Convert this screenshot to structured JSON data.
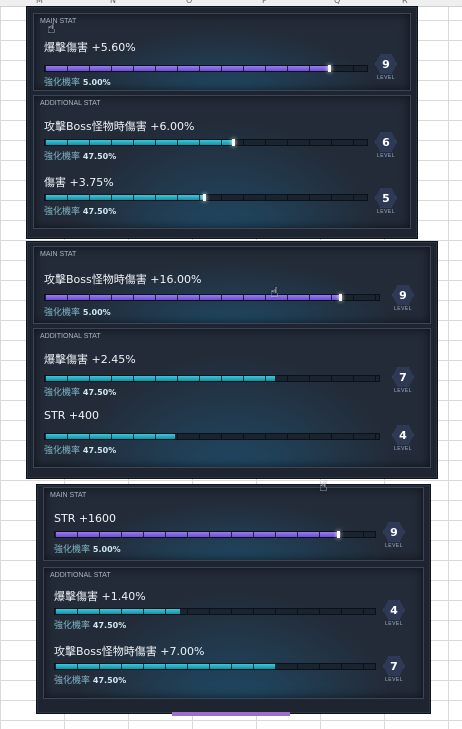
{
  "column_headers": [
    "M",
    "N",
    "O",
    "P",
    "Q",
    "R"
  ],
  "panels": [
    {
      "main": {
        "title": "MAIN STAT",
        "stat": "爆擊傷害 +5.60%",
        "fill": 0.89,
        "rate_label": "強化機率",
        "rate_value": "5.00%",
        "level": "9",
        "level_label": "LEVEL"
      },
      "additional": {
        "title": "ADDITIONAL STAT",
        "stats": [
          {
            "stat": "攻擊Boss怪物時傷害 +6.00%",
            "fill": 0.59,
            "rate_label": "強化機率",
            "rate_value": "47.50%",
            "level": "6",
            "level_label": "LEVEL"
          },
          {
            "stat": "傷害 +3.75%",
            "fill": 0.5,
            "rate_label": "強化機率",
            "rate_value": "47.50%",
            "level": "5",
            "level_label": "LEVEL"
          }
        ]
      }
    },
    {
      "main": {
        "title": "MAIN STAT",
        "stat": "攻擊Boss怪物時傷害 +16.00%",
        "fill": 0.89,
        "rate_label": "強化機率",
        "rate_value": "5.00%",
        "level": "9",
        "level_label": "LEVEL"
      },
      "additional": {
        "title": "ADDITIONAL STAT",
        "stats": [
          {
            "stat": "爆擊傷害 +2.45%",
            "fill": 0.69,
            "rate_label": "強化機率",
            "rate_value": "47.50%",
            "level": "7",
            "level_label": "LEVEL"
          },
          {
            "stat": "STR +400",
            "fill": 0.39,
            "rate_label": "強化機率",
            "rate_value": "47.50%",
            "level": "4",
            "level_label": "LEVEL"
          }
        ]
      }
    },
    {
      "main": {
        "title": "MAIN STAT",
        "stat": "STR +1600",
        "fill": 0.89,
        "rate_label": "強化機率",
        "rate_value": "5.00%",
        "level": "9",
        "level_label": "LEVEL"
      },
      "additional": {
        "title": "ADDITIONAL STAT",
        "stats": [
          {
            "stat": "爆擊傷害 +1.40%",
            "fill": 0.39,
            "rate_label": "強化機率",
            "rate_value": "47.50%",
            "level": "4",
            "level_label": "LEVEL"
          },
          {
            "stat": "攻擊Boss怪物時傷害 +7.00%",
            "fill": 0.69,
            "rate_label": "強化機率",
            "rate_value": "47.50%",
            "level": "7",
            "level_label": "LEVEL"
          }
        ]
      }
    }
  ]
}
